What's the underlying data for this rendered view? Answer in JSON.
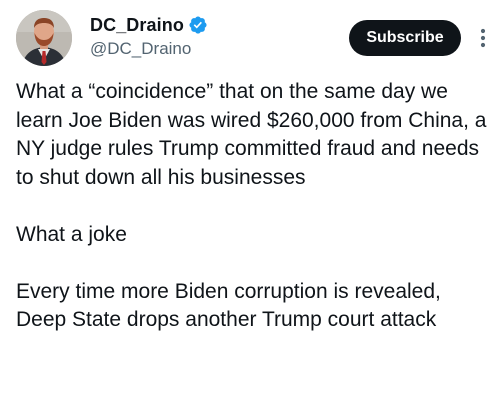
{
  "author": {
    "display_name": "DC_Draino",
    "handle": "@DC_Draino",
    "verified": true,
    "avatar_icon": "profile-photo-avatar"
  },
  "actions": {
    "subscribe_label": "Subscribe",
    "more_icon": "more-vertical-icon"
  },
  "post": {
    "paragraphs": [
      "What a “coincidence” that on the same day we learn Joe Biden was wired $260,000 from China, a NY judge rules Trump committed fraud and needs to shut down all his businesses",
      "What a joke",
      "Every time more Biden corruption is revealed, Deep State drops another Trump court attack"
    ]
  },
  "colors": {
    "verified_badge": "#1d9bf0",
    "subscribe_bg": "#0f1419",
    "handle_text": "#536471"
  }
}
